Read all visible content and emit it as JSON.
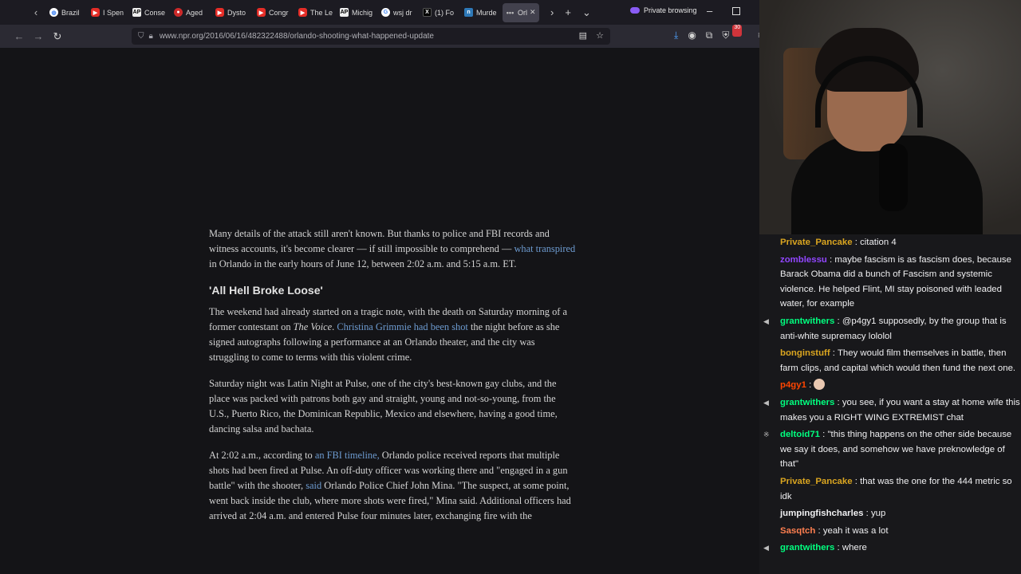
{
  "browser": {
    "tabs": [
      {
        "label": "Brazil",
        "icon": "globe-icon"
      },
      {
        "label": "I Spen",
        "icon": "youtube-icon"
      },
      {
        "label": "Conse",
        "icon": "ap-icon"
      },
      {
        "label": "Aged",
        "icon": "reddit-icon"
      },
      {
        "label": "Dysto",
        "icon": "youtube-icon"
      },
      {
        "label": "Congr",
        "icon": "youtube-icon"
      },
      {
        "label": "The Le",
        "icon": "youtube-icon"
      },
      {
        "label": "Michig",
        "icon": "ap-icon"
      },
      {
        "label": "wsj dr",
        "icon": "google-icon"
      },
      {
        "label": "(1) Fo",
        "icon": "x-icon"
      },
      {
        "label": "Murde",
        "icon": "npr-icon"
      },
      {
        "label": "Orl",
        "icon": "dots-icon",
        "active": true
      }
    ],
    "private_label": "Private browsing",
    "url": "www.npr.org/2016/06/16/482322488/orlando-shooting-what-happened-update",
    "extension_badge": "30"
  },
  "article": {
    "p1_before": "Many details of the attack still aren't known. But thanks to police and FBI records and witness accounts, it's become clearer — if still impossible to comprehend — ",
    "p1_link": "what transpired",
    "p1_after": " in Orlando in the early hours of June 12, between 2:02 a.m. and 5:15 a.m. ET.",
    "heading": "'All Hell Broke Loose'",
    "p2_before": "The weekend had already started on a tragic note, with the death on Saturday morning of a former contestant on ",
    "p2_em": "The Voice",
    "p2_mid": ". ",
    "p2_link": "Christina Grimmie had been shot",
    "p2_after": " the night before as she signed autographs following a performance at an Orlando theater, and the city was struggling to come to terms with this violent crime.",
    "p3": "Saturday night was Latin Night at Pulse, one of the city's best-known gay clubs, and the place was packed with patrons both gay and straight, young and not-so-young, from the U.S., Puerto Rico, the Dominican Republic, Mexico and elsewhere, having a good time, dancing salsa and bachata.",
    "p4_before": "At 2:02 a.m., according to ",
    "p4_link1": "an FBI timeline,",
    "p4_mid": " Orlando police received reports that multiple shots had been fired at Pulse. An off-duty officer was working there and \"engaged in a gun battle\" with the shooter, ",
    "p4_link2": "said",
    "p4_after": " Orlando Police Chief John Mina. \"The suspect, at some point, went back inside the club, where more shots were fired,\" Mina said. Additional officers had arrived at 2:04 a.m. and entered Pulse four minutes later, exchanging fire with the"
  },
  "chat": {
    "messages": [
      {
        "user": "Private_Pancake",
        "color": "#daa520",
        "text": "citation 4",
        "badge": ""
      },
      {
        "user": "zomblessu",
        "color": "#9146ff",
        "text": "maybe fascism is as fascism does, because Barack Obama did a bunch of Fascism and systemic violence. He helped Flint, MI stay poisoned with leaded water, for example",
        "badge": ""
      },
      {
        "user": "grantwithers",
        "color": "#00ff7f",
        "text": "@p4gy1 supposedly, by the group that is anti-white supremacy lololol",
        "badge": "◀"
      },
      {
        "user": "bonginstuff",
        "color": "#daa520",
        "text": "They would film themselves in battle, then farm clips, and capital which would then fund the next one.",
        "badge": ""
      },
      {
        "user": "p4gy1",
        "color": "#ff4500",
        "text": "",
        "badge": "",
        "emote": true
      },
      {
        "user": "grantwithers",
        "color": "#00ff7f",
        "text": "you see, if you want a stay at home wife this makes you a RIGHT WING EXTREMIST chat",
        "badge": "◀"
      },
      {
        "user": "deltoid71",
        "color": "#00ff7f",
        "text": "\"this thing happens on the other side because we say it does, and somehow we have preknowledge of that\"",
        "badge": "※"
      },
      {
        "user": "Private_Pancake",
        "color": "#daa520",
        "text": "that was the one for the 444 metric so idk",
        "badge": ""
      },
      {
        "user": "jumpingfishcharles",
        "color": "#efeff1",
        "text": "yup",
        "badge": ""
      },
      {
        "user": "Sasqtch",
        "color": "#ff7f50",
        "text": "yeah it was a lot",
        "badge": ""
      },
      {
        "user": "grantwithers",
        "color": "#00ff7f",
        "text": "where",
        "badge": "◀"
      }
    ]
  }
}
